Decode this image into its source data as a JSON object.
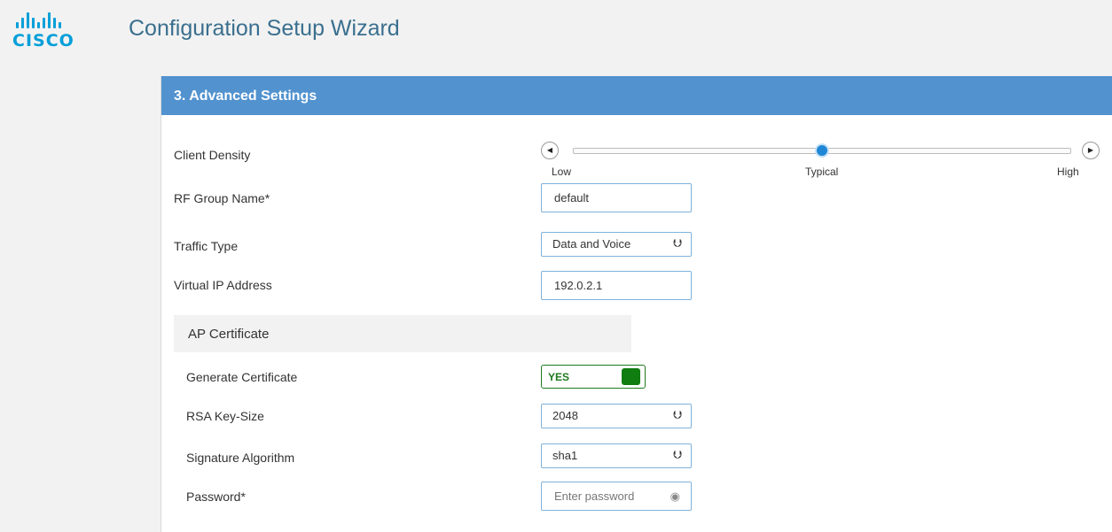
{
  "header": {
    "logo_text": "CISCO",
    "title": "Configuration Setup Wizard"
  },
  "panel": {
    "title": "3. Advanced Settings"
  },
  "client_density": {
    "label": "Client Density",
    "labels": {
      "low": "Low",
      "typical": "Typical",
      "high": "High"
    },
    "value_fraction": 0.5,
    "left_arrow": "◀",
    "right_arrow": "▶"
  },
  "rf_group": {
    "label": "RF Group Name*",
    "value": "default"
  },
  "traffic_type": {
    "label": "Traffic Type",
    "value": "Data and Voice"
  },
  "virtual_ip": {
    "label": "Virtual IP Address",
    "value": "192.0.2.1"
  },
  "ap_certificate": {
    "section_title": "AP Certificate"
  },
  "generate_certificate": {
    "label": "Generate Certificate",
    "toggle_text": "YES",
    "on": true
  },
  "rsa_key_size": {
    "label": "RSA Key-Size",
    "value": "2048"
  },
  "signature_algorithm": {
    "label": "Signature Algorithm",
    "value": "sha1"
  },
  "password": {
    "label": "Password*",
    "placeholder": "Enter password"
  },
  "icons": {
    "caret": "chevron-down-icon",
    "eye": "eye-slash-icon",
    "logo": "cisco-logo-icon"
  },
  "colors": {
    "header_blue": "#5192cf",
    "brand": "#049fd9",
    "toggle_green": "#0f7d0f",
    "slider_thumb": "#1f87d6"
  }
}
